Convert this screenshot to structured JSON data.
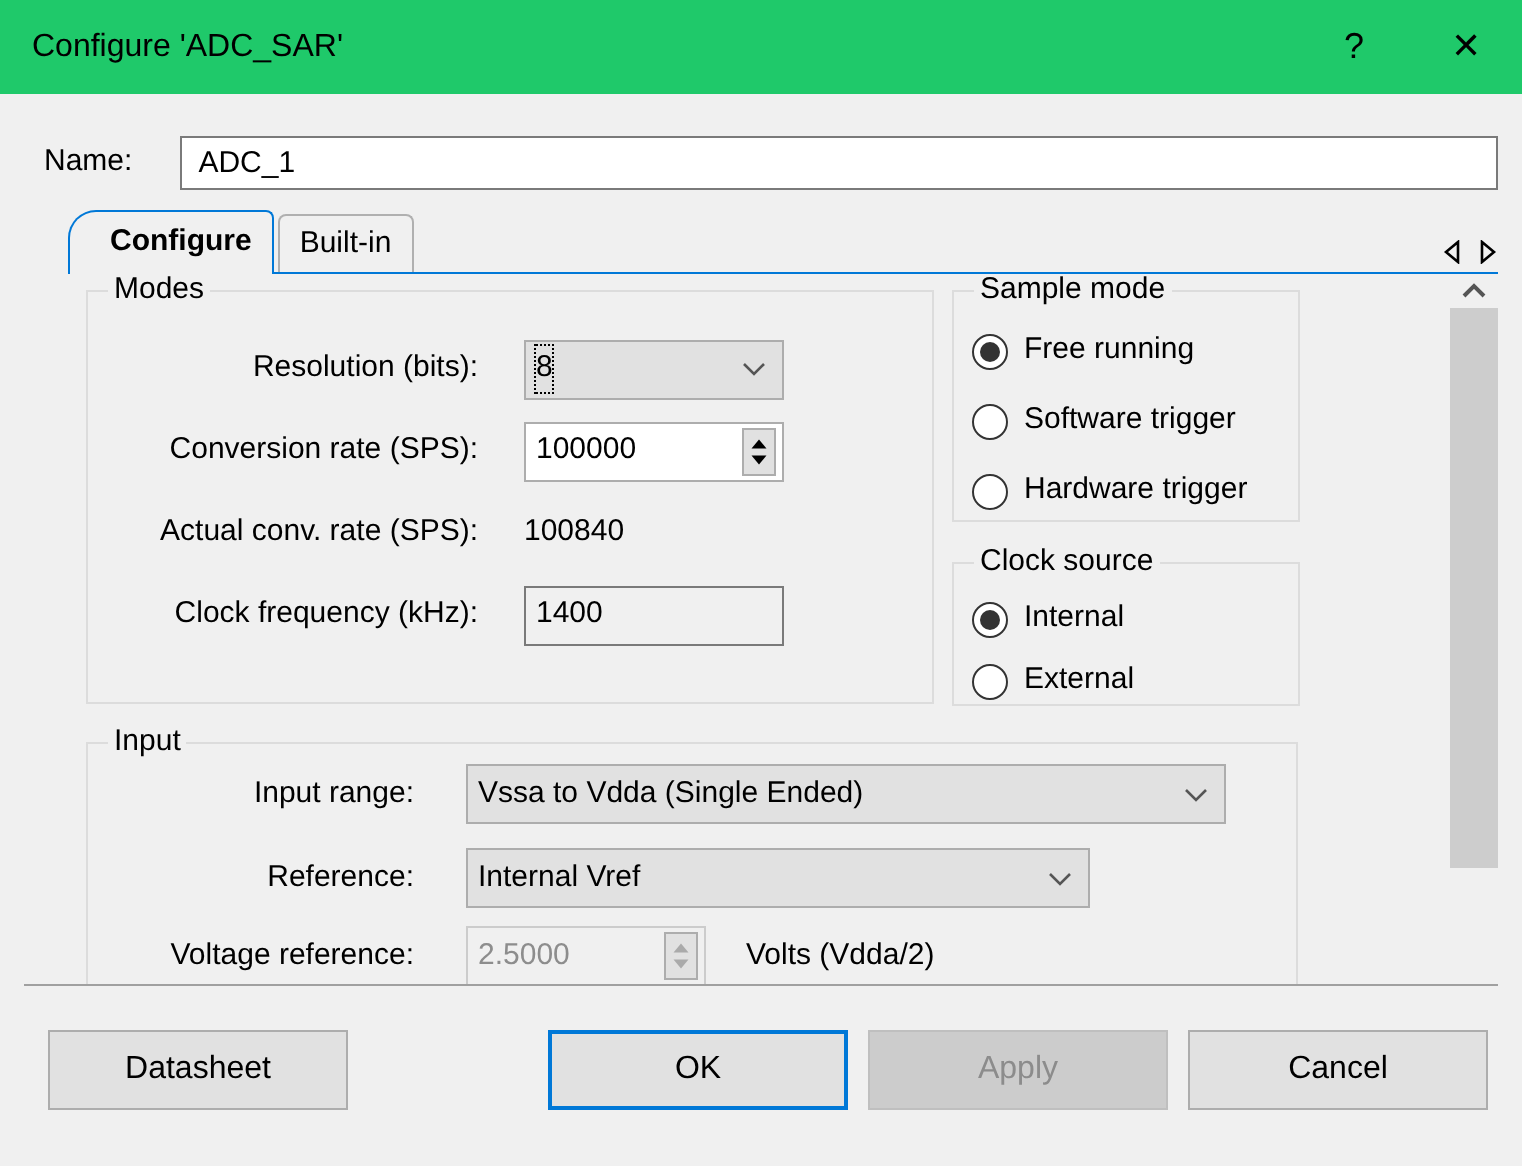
{
  "window": {
    "title": "Configure 'ADC_SAR'",
    "help": "?",
    "close": "✕"
  },
  "name_field": {
    "label": "Name:",
    "value": "ADC_1"
  },
  "tabs": [
    {
      "label": "Configure",
      "selected": true
    },
    {
      "label": "Built-in",
      "selected": false
    }
  ],
  "modes": {
    "legend": "Modes",
    "rows": [
      {
        "kind": "dropdown",
        "label": "Resolution (bits):",
        "value": "8",
        "disabled": false
      },
      {
        "kind": "spinner",
        "label": "Conversion rate (SPS):",
        "value": "100000",
        "disabled": false
      },
      {
        "kind": "text",
        "label": "Actual conv. rate (SPS):",
        "value": "100840"
      },
      {
        "kind": "field",
        "label": "Clock frequency (kHz):",
        "value": "1400",
        "disabled": false
      }
    ]
  },
  "sample_mode": {
    "legend": "Sample mode",
    "options": [
      {
        "label": "Free running",
        "selected": true
      },
      {
        "label": "Software trigger",
        "selected": false
      },
      {
        "label": "Hardware trigger",
        "selected": false
      }
    ]
  },
  "clock_source": {
    "legend": "Clock source",
    "options": [
      {
        "label": "Internal",
        "selected": true
      },
      {
        "label": "External",
        "selected": false
      }
    ]
  },
  "input": {
    "legend": "Input",
    "rows": [
      {
        "kind": "dropdown",
        "label": "Input range:",
        "value": "Vssa to Vdda (Single Ended)",
        "disabled": false
      },
      {
        "kind": "dropdown",
        "label": "Reference:",
        "value": "Internal Vref",
        "disabled": false
      },
      {
        "kind": "spinner",
        "label": "Voltage reference:",
        "value": "2.5000",
        "disabled": true,
        "unit": "Volts (Vdda/2)"
      }
    ]
  },
  "buttons": [
    {
      "label": "Datasheet",
      "disabled": false,
      "default": false
    },
    {
      "label": "OK",
      "disabled": false,
      "default": true
    },
    {
      "label": "Apply",
      "disabled": true,
      "default": false
    },
    {
      "label": "Cancel",
      "disabled": false,
      "default": false
    }
  ]
}
